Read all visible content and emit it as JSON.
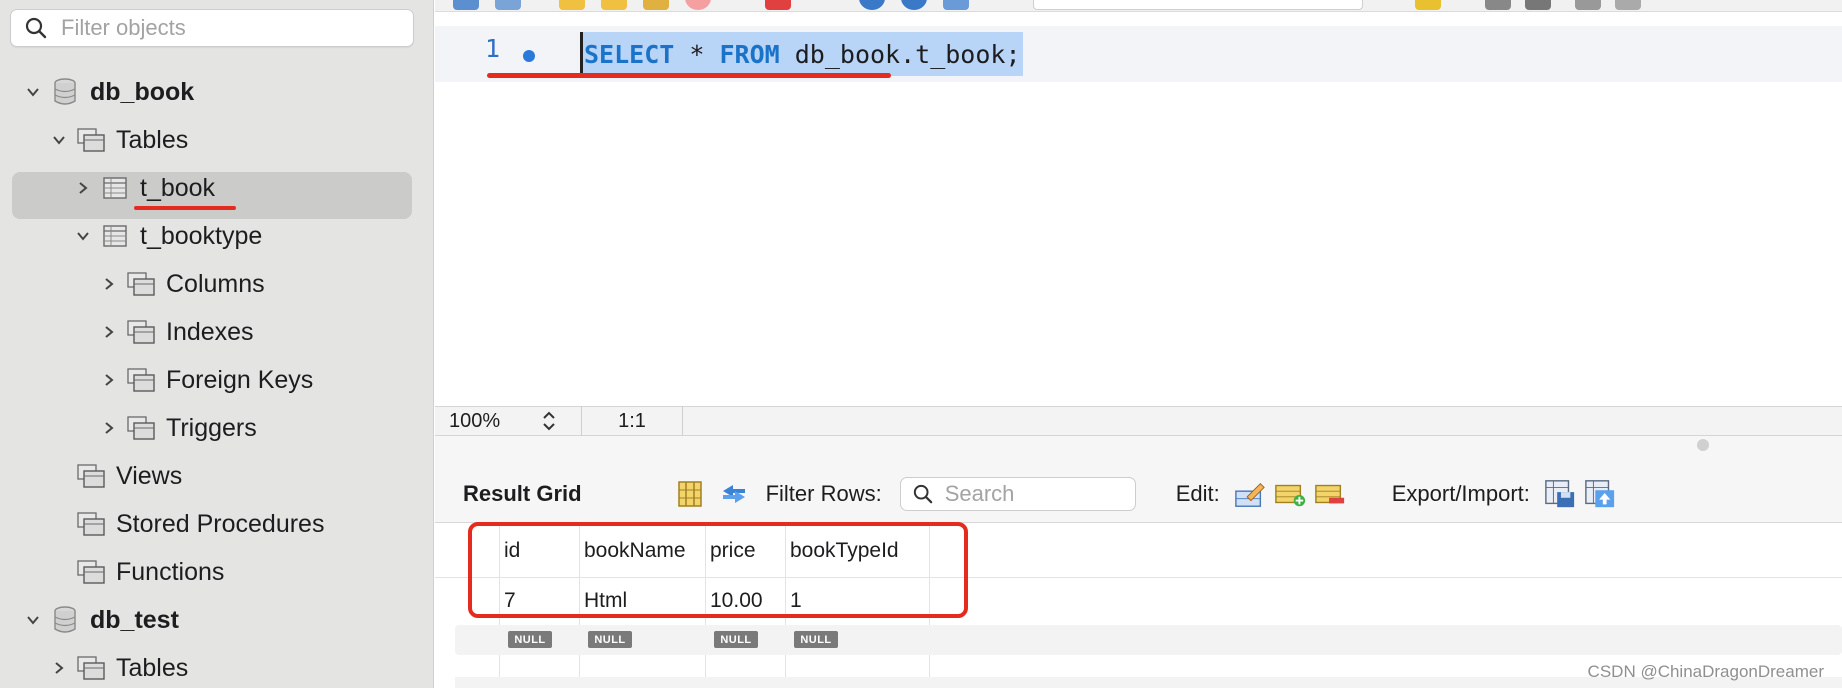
{
  "sidebar": {
    "filter_placeholder": "Filter objects",
    "tree": [
      {
        "label": "db_book",
        "level": 0,
        "expanded": true,
        "icon": "database-icon",
        "bold": true
      },
      {
        "label": "Tables",
        "level": 1,
        "expanded": true,
        "icon": "folder-tables-icon"
      },
      {
        "label": "t_book",
        "level": 2,
        "expanded": false,
        "icon": "table-icon",
        "selected": true
      },
      {
        "label": "t_booktype",
        "level": 2,
        "expanded": true,
        "icon": "table-icon"
      },
      {
        "label": "Columns",
        "level": 3,
        "expanded": false,
        "icon": "columns-folder-icon"
      },
      {
        "label": "Indexes",
        "level": 3,
        "expanded": false,
        "icon": "indexes-folder-icon"
      },
      {
        "label": "Foreign Keys",
        "level": 3,
        "expanded": false,
        "icon": "foreign-keys-folder-icon"
      },
      {
        "label": "Triggers",
        "level": 3,
        "expanded": false,
        "icon": "triggers-folder-icon"
      },
      {
        "label": "Views",
        "level": 1,
        "icon": "folder-views-icon"
      },
      {
        "label": "Stored Procedures",
        "level": 1,
        "icon": "folder-procedures-icon"
      },
      {
        "label": "Functions",
        "level": 1,
        "icon": "folder-functions-icon"
      },
      {
        "label": "db_test",
        "level": 0,
        "expanded": true,
        "icon": "database-icon",
        "bold": true
      },
      {
        "label": "Tables",
        "level": 1,
        "expanded": false,
        "icon": "folder-tables-icon"
      }
    ]
  },
  "editor": {
    "line_number": "1",
    "sql": {
      "kw1": "SELECT",
      "star": " * ",
      "kw2": "FROM",
      "rest": " db_book.t_book;"
    }
  },
  "statusbar": {
    "zoom": "100%",
    "cursor": "1:1"
  },
  "result_toolbar": {
    "title": "Result Grid",
    "filter_label": "Filter Rows:",
    "search_placeholder": "Search",
    "edit_label": "Edit:",
    "export_label": "Export/Import:"
  },
  "grid": {
    "columns": [
      "id",
      "bookName",
      "price",
      "bookTypeId"
    ],
    "rows": [
      [
        "7",
        "Html",
        "10.00",
        "1"
      ]
    ],
    "null_label": "NULL"
  },
  "watermark": "CSDN @ChinaDragonDreamer",
  "colors": {
    "accent": "#1a73c8",
    "annotation_red": "#e42b1e",
    "selection": "#b8d4f6"
  }
}
